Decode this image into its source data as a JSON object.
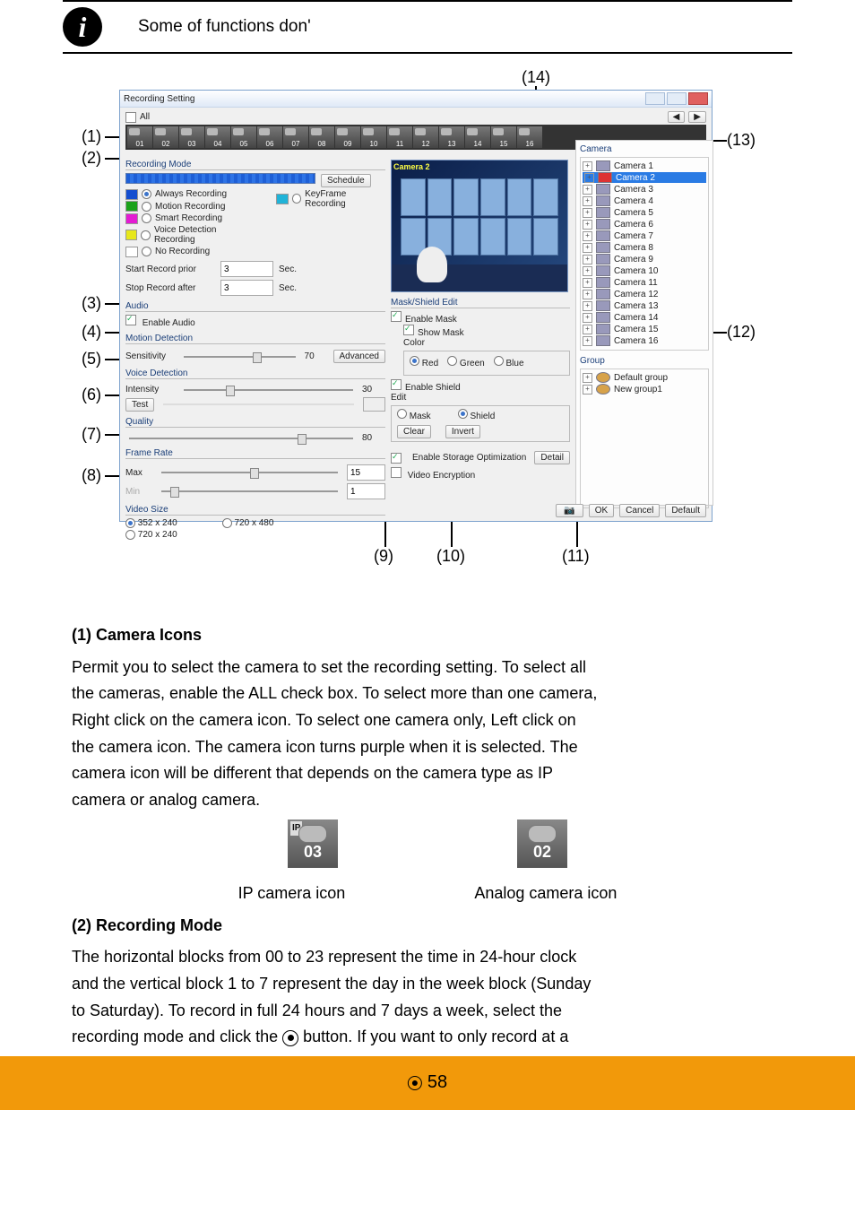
{
  "note_text": "Some of functions don'",
  "callouts": {
    "c1": "(1)",
    "c2": "(2)",
    "c3": "(3)",
    "c4": "(4)",
    "c5": "(5)",
    "c6": "(6)",
    "c7": "(7)",
    "c8": "(8)",
    "c9": "(9)",
    "c10": "(10)",
    "c11": "(11)",
    "c12": "(12)",
    "c13": "(13)",
    "c14": "(14)"
  },
  "dialog": {
    "title": "Recording Setting",
    "all": "All",
    "camera_strip": [
      "01",
      "02",
      "03",
      "04",
      "05",
      "06",
      "07",
      "08",
      "09",
      "10",
      "11",
      "12",
      "13",
      "14",
      "15",
      "16"
    ],
    "recording_mode": {
      "title": "Recording Mode",
      "schedule_btn": "Schedule",
      "modes": [
        {
          "label": "Always Recording",
          "color": "#164fd0",
          "selected": true
        },
        {
          "label": "Motion Recording",
          "color": "#1aa11a",
          "selected": false
        },
        {
          "label": "Smart Recording",
          "color": "#e41bd3",
          "selected": false
        },
        {
          "label": "Voice Detection Recording",
          "color": "#e7e71a",
          "selected": false
        },
        {
          "label": "No Recording",
          "color": "#ffffff",
          "selected": false
        }
      ],
      "keyframe_label": "KeyFrame Recording",
      "keyframe_color": "#20b3d8",
      "start_prior_label": "Start Record prior",
      "start_prior_value": "3",
      "stop_after_label": "Stop Record after",
      "stop_after_value": "3",
      "unit": "Sec."
    },
    "audio": {
      "title": "Audio",
      "enable": "Enable Audio"
    },
    "motion": {
      "title": "Motion Detection",
      "sensitivity_label": "Sensitivity",
      "sensitivity_value": "70",
      "advanced_btn": "Advanced"
    },
    "voice": {
      "title": "Voice Detection",
      "intensity_label": "Intensity",
      "intensity_value": "30",
      "test_btn": "Test"
    },
    "quality": {
      "title": "Quality",
      "value": "80"
    },
    "frame_rate": {
      "title": "Frame Rate",
      "max_label": "Max",
      "max_value": "15",
      "min_label": "Min",
      "min_value": "1"
    },
    "video_size": {
      "title": "Video Size",
      "opts": [
        "352 x 240",
        "720 x 240",
        "720 x 480"
      ],
      "selected": "352 x 240"
    },
    "preview_tag": "Camera 2",
    "mask": {
      "title": "Mask/Shield Edit",
      "enable_mask": "Enable Mask",
      "show_mask": "Show Mask",
      "color_label": "Color",
      "colors": [
        "Red",
        "Green",
        "Blue"
      ],
      "color_selected": "Red",
      "enable_shield": "Enable Shield",
      "edit_label": "Edit",
      "edit_opts": [
        "Mask",
        "Shield"
      ],
      "edit_selected": "Shield",
      "clear_btn": "Clear",
      "invert_btn": "Invert"
    },
    "storage_opt": "Enable Storage Optimization",
    "video_encrypt": "Video Encryption",
    "detail_btn": "Detail",
    "camera_panel": {
      "title": "Camera",
      "items": [
        "Camera 1",
        "Camera 2",
        "Camera 3",
        "Camera 4",
        "Camera 5",
        "Camera 6",
        "Camera 7",
        "Camera 8",
        "Camera 9",
        "Camera 10",
        "Camera 11",
        "Camera 12",
        "Camera 13",
        "Camera 14",
        "Camera 15",
        "Camera 16"
      ],
      "selected_index": 1
    },
    "group_panel": {
      "title": "Group",
      "items": [
        "Default group",
        "New group1"
      ]
    },
    "ok": "OK",
    "cancel": "Cancel",
    "default": "Default"
  },
  "body": {
    "section_title": "(1) Camera Icons",
    "p1_a": "Permit you to select the camera to set the recording setting. To select all",
    "p1_b": "the cameras, enable the ALL check box. To select more than one camera,",
    "p1_c": "Right click on the camera icon. To select one camera only, Left click on",
    "p1_d": "the camera icon. The camera icon turns purple when it is selected. The",
    "p1_e": "camera icon will be different that depends on the camera type as IP",
    "p1_f": "camera or analog camera.",
    "icon_ip": "03",
    "icon_an": "02",
    "caption_ip": "IP camera icon                             Analog camera icon",
    "section2_title": "(2) Recording Mode",
    "p2_a": "The horizontal blocks from 00 to 23 represent the time in 24-hour clock",
    "p2_b": "and the vertical block 1 to 7 represent the day in the week block (Sunday",
    "p2_c": "to Saturday). To record in full 24 hours and 7 days a week, select the",
    "p2_d": "recording mode and click the",
    "p2_d_bullet": "button. If you want to only record at a"
  },
  "footer": {
    "page": "58"
  }
}
